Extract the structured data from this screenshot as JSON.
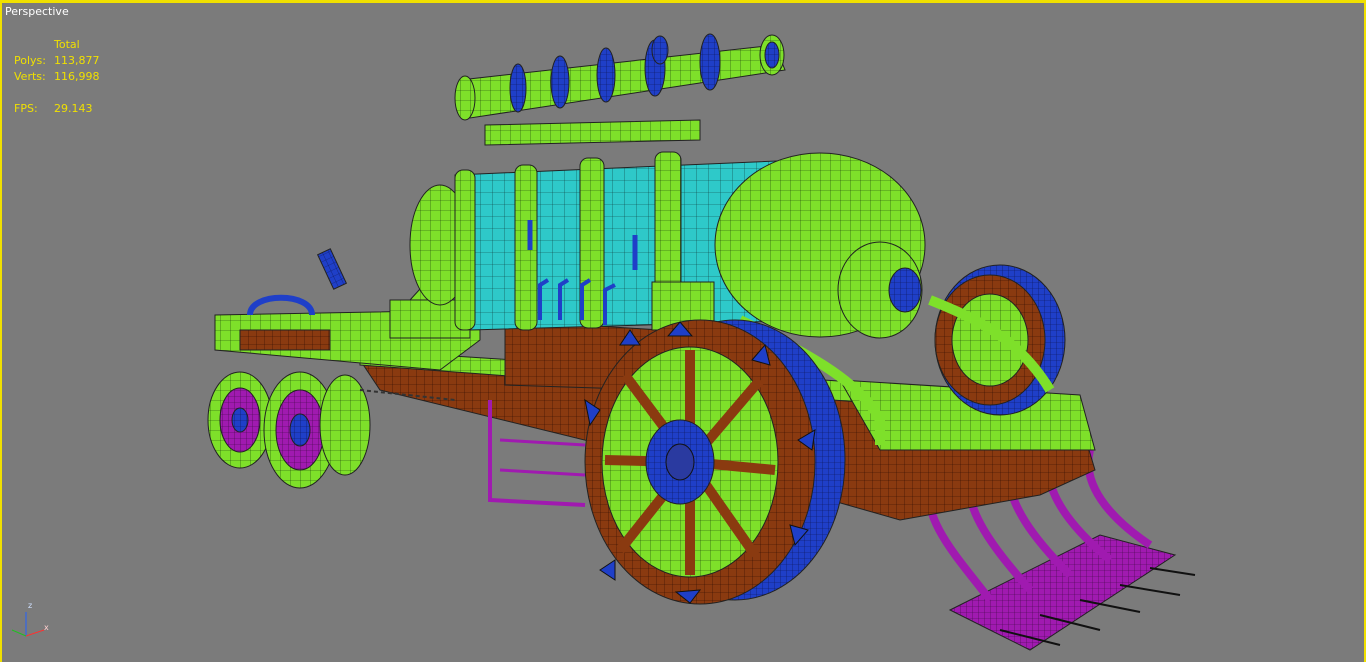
{
  "viewport": {
    "label": "Perspective",
    "stats": {
      "total_header": "Total",
      "polys_label": "Polys:",
      "polys_value": "113,877",
      "verts_label": "Verts:",
      "verts_value": "116,998",
      "fps_label": "FPS:",
      "fps_value": "29.143"
    },
    "gizmo": {
      "z": "z",
      "x": "x"
    }
  },
  "colors": {
    "viewport_bg": "#7b7b7b",
    "active_border": "#f0e000",
    "stats_text": "#f0e000",
    "mesh_green": "#7ee02a",
    "mesh_cyan": "#2ec9c9",
    "mesh_blue": "#1f3fc8",
    "mesh_brown": "#8a3a10",
    "mesh_magenta": "#a01ab0"
  }
}
